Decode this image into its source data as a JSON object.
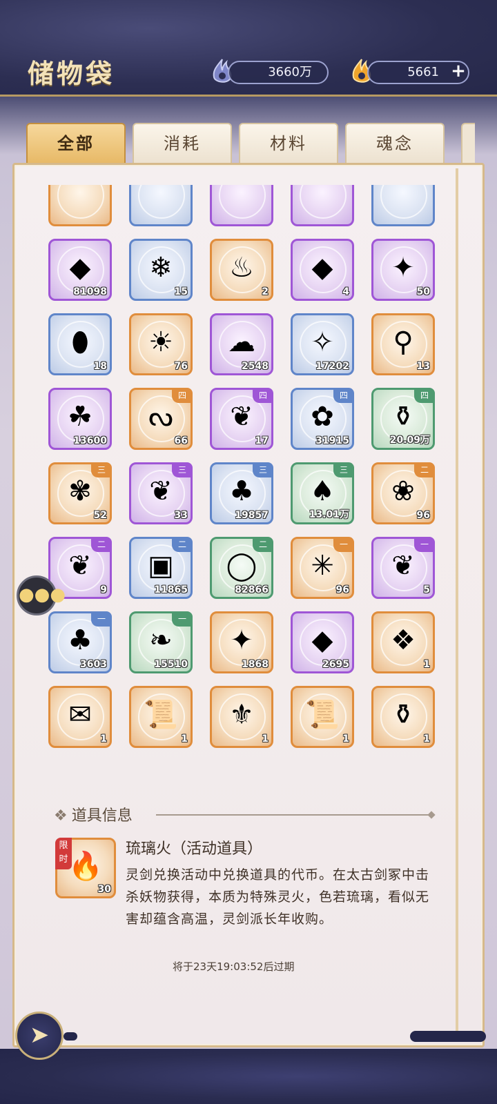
{
  "header": {
    "title": "储物袋",
    "currency1": {
      "value": "3660万",
      "icon": "spirit-flame-icon",
      "color": "#7f86c9"
    },
    "currency2": {
      "value": "5661",
      "icon": "gold-flame-icon",
      "color": "#f0a52c"
    },
    "plus_label": "+"
  },
  "tabs": [
    {
      "label": "全部",
      "active": true
    },
    {
      "label": "消耗",
      "active": false
    },
    {
      "label": "材料",
      "active": false
    },
    {
      "label": "魂念",
      "active": false
    }
  ],
  "grid": {
    "items": [
      {
        "rarity": "orange",
        "icon": "partial-item-icon",
        "glyph": "",
        "qty": "",
        "tier": ""
      },
      {
        "rarity": "blue",
        "icon": "partial-item-icon",
        "glyph": "",
        "qty": "",
        "tier": ""
      },
      {
        "rarity": "purple",
        "icon": "partial-item-icon",
        "glyph": "",
        "qty": "",
        "tier": ""
      },
      {
        "rarity": "purple",
        "icon": "partial-item-icon",
        "glyph": "",
        "qty": "",
        "tier": ""
      },
      {
        "rarity": "blue",
        "icon": "partial-item-icon",
        "glyph": "",
        "qty": "",
        "tier": ""
      },
      {
        "rarity": "purple",
        "icon": "purple-token-icon",
        "glyph": "◆",
        "qty": "81098",
        "tier": ""
      },
      {
        "rarity": "blue",
        "icon": "ice-crystal-icon",
        "glyph": "❄",
        "qty": "15",
        "tier": ""
      },
      {
        "rarity": "orange",
        "icon": "orange-gourd-icon",
        "glyph": "♨",
        "qty": "2",
        "tier": ""
      },
      {
        "rarity": "purple",
        "icon": "purple-gem-icon",
        "glyph": "◆",
        "qty": "4",
        "tier": ""
      },
      {
        "rarity": "purple",
        "icon": "purple-crystal-cluster-icon",
        "glyph": "✦",
        "qty": "50",
        "tier": ""
      },
      {
        "rarity": "blue",
        "icon": "spirit-egg-icon",
        "glyph": "⬮",
        "qty": "18",
        "tier": ""
      },
      {
        "rarity": "orange",
        "icon": "sun-orb-icon",
        "glyph": "☀",
        "qty": "76",
        "tier": ""
      },
      {
        "rarity": "purple",
        "icon": "swirl-cloud-icon",
        "glyph": "☁",
        "qty": "2548",
        "tier": ""
      },
      {
        "rarity": "blue",
        "icon": "gold-ore-icon",
        "glyph": "✧",
        "qty": "17202",
        "tier": ""
      },
      {
        "rarity": "orange",
        "icon": "scroll-rod-icon",
        "glyph": "⚲",
        "qty": "13",
        "tier": ""
      },
      {
        "rarity": "purple",
        "icon": "spirit-grass-icon",
        "glyph": "☘",
        "qty": "13600",
        "tier": ""
      },
      {
        "rarity": "orange",
        "icon": "serpent-vine-icon",
        "glyph": "ᔓ",
        "qty": "66",
        "tier": "四"
      },
      {
        "rarity": "purple",
        "icon": "red-berry-icon",
        "glyph": "❦",
        "qty": "17",
        "tier": "四"
      },
      {
        "rarity": "blue",
        "icon": "blue-flower-icon",
        "glyph": "✿",
        "qty": "31915",
        "tier": "四"
      },
      {
        "rarity": "green",
        "icon": "vase-icon",
        "glyph": "⚱",
        "qty": "20.09万",
        "tier": "四"
      },
      {
        "rarity": "orange",
        "icon": "blue-lily-icon",
        "glyph": "✾",
        "qty": "52",
        "tier": "三"
      },
      {
        "rarity": "purple",
        "icon": "berry-branch-icon",
        "glyph": "❦",
        "qty": "33",
        "tier": "三"
      },
      {
        "rarity": "blue",
        "icon": "purple-mushroom-icon",
        "glyph": "♣",
        "qty": "19857",
        "tier": "三"
      },
      {
        "rarity": "green",
        "icon": "horn-icon",
        "glyph": "♠",
        "qty": "13.01万",
        "tier": "三"
      },
      {
        "rarity": "orange",
        "icon": "lotus-icon",
        "glyph": "❀",
        "qty": "96",
        "tier": "二"
      },
      {
        "rarity": "purple",
        "icon": "green-berry-icon",
        "glyph": "❦",
        "qty": "9",
        "tier": "二"
      },
      {
        "rarity": "blue",
        "icon": "white-cube-icon",
        "glyph": "▣",
        "qty": "11865",
        "tier": "二"
      },
      {
        "rarity": "green",
        "icon": "jade-ring-icon",
        "glyph": "◯",
        "qty": "82866",
        "tier": "二"
      },
      {
        "rarity": "orange",
        "icon": "purple-grass-icon",
        "glyph": "✳",
        "qty": "96",
        "tier": "一"
      },
      {
        "rarity": "purple",
        "icon": "orange-berry-icon",
        "glyph": "❦",
        "qty": "5",
        "tier": "一"
      },
      {
        "rarity": "blue",
        "icon": "red-tree-icon",
        "glyph": "♣",
        "qty": "3603",
        "tier": "一"
      },
      {
        "rarity": "green",
        "icon": "coral-icon",
        "glyph": "❧",
        "qty": "15510",
        "tier": "一"
      },
      {
        "rarity": "orange",
        "icon": "gold-crystal-icon",
        "glyph": "✦",
        "qty": "1868",
        "tier": ""
      },
      {
        "rarity": "purple",
        "icon": "amethyst-icon",
        "glyph": "◆",
        "qty": "2695",
        "tier": ""
      },
      {
        "rarity": "orange",
        "icon": "ice-shard-icon",
        "glyph": "❖",
        "qty": "1",
        "tier": ""
      },
      {
        "rarity": "orange",
        "icon": "talisman-icon",
        "glyph": "✉",
        "qty": "1",
        "tier": ""
      },
      {
        "rarity": "orange",
        "icon": "scroll-icon",
        "glyph": "📜",
        "qty": "1",
        "tier": ""
      },
      {
        "rarity": "orange",
        "icon": "amulet-icon",
        "glyph": "⚜",
        "qty": "1",
        "tier": ""
      },
      {
        "rarity": "orange",
        "icon": "scroll-icon",
        "glyph": "📜",
        "qty": "1",
        "tier": ""
      },
      {
        "rarity": "orange",
        "icon": "pouch-icon",
        "glyph": "⚱",
        "qty": "1",
        "tier": ""
      },
      {
        "rarity": "orange",
        "icon": "partial-item-icon",
        "glyph": "",
        "qty": "",
        "tier": ""
      },
      {
        "rarity": "orange",
        "icon": "partial-item-icon",
        "glyph": "",
        "qty": "",
        "tier": ""
      },
      {
        "rarity": "orange",
        "icon": "partial-item-icon",
        "glyph": "",
        "qty": "",
        "tier": ""
      },
      {
        "rarity": "orange",
        "icon": "partial-item-icon",
        "glyph": "",
        "qty": "",
        "tier": ""
      },
      {
        "rarity": "orange",
        "icon": "partial-item-icon",
        "glyph": "",
        "qty": "",
        "tier": ""
      }
    ]
  },
  "info": {
    "heading": "道具信息",
    "item_name": "琉璃火（活动道具）",
    "item_qty": "30",
    "item_icon": "blue-fire-icon",
    "limited_label": "限时",
    "description": "灵剑兑换活动中兑换道具的代币。在太古剑冢中击杀妖物获得，本质为特殊灵火，色若琉璃，看似无害却蕴含高温，灵剑派长年收购。",
    "expire_text": "将于23天19:03:52后过期"
  },
  "nav": {
    "back_icon": "back-arrow-icon",
    "chat_icon": "chat-bubble-icon"
  }
}
